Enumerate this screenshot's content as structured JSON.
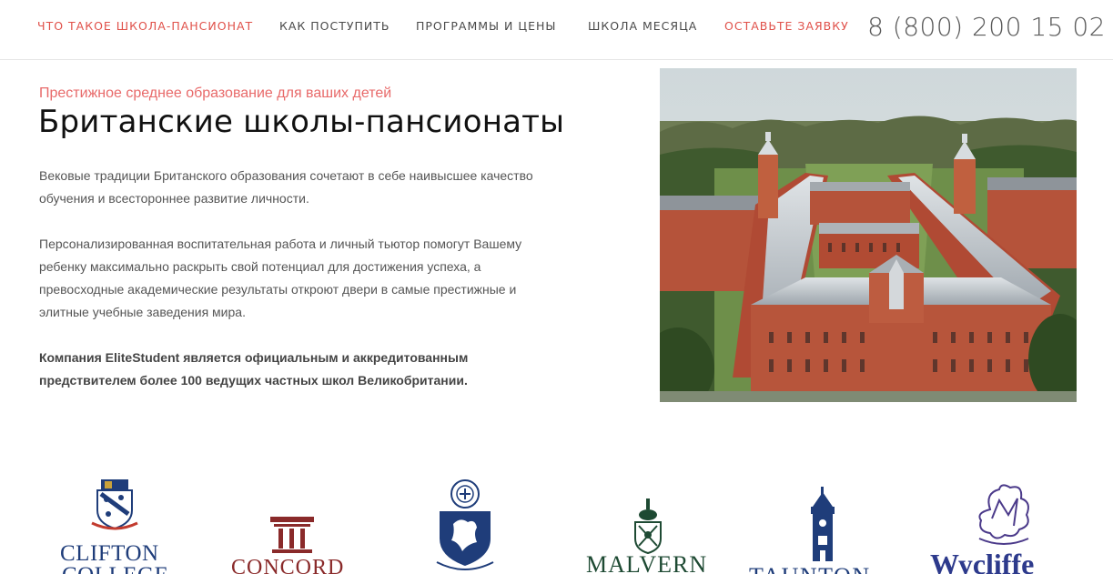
{
  "nav": {
    "items": [
      {
        "label": "ЧТО ТАКОЕ ШКОЛА-ПАНСИОНАТ"
      },
      {
        "label": "КАК ПОСТУПИТЬ"
      },
      {
        "label": "ПРОГРАММЫ И ЦЕНЫ"
      },
      {
        "label": "ШКОЛА МЕСЯЦА"
      },
      {
        "label": "ОСТАВЬТЕ ЗАЯВКУ"
      }
    ],
    "phone": "8 (800) 200 15 02"
  },
  "hero": {
    "kicker": "Престижное среднее образование для ваших детей",
    "title": "Британские школы-пансионаты",
    "paragraphs": [
      "Вековые традиции Британского образования сочетают в себе наивысшее качество обучения и всестороннее развитие личности.",
      "Персонализированная воспитательная работа и личный тьютор помогут Вашему ребенку максимально раскрыть свой потенциал для достижения успеха, а превосходные академические результаты откроют двери в самые престижные и элитные учебные заведения мира.",
      "Компания EliteStudent является официальным и аккредитованным предствителем более 100 ведущих частных школ Великобритании."
    ]
  },
  "logos": [
    {
      "name": "CLIFTON",
      "name2": "COLLEGE",
      "icon": "crest-icon"
    },
    {
      "name": "CONCORD",
      "icon": "columns-icon"
    },
    {
      "name": "",
      "icon": "shield-lion-icon"
    },
    {
      "name": "MALVERN",
      "icon": "crest-icon"
    },
    {
      "name": "TAUNTON",
      "icon": "tower-icon"
    },
    {
      "name": "Wycliffe",
      "icon": "griffin-icon"
    }
  ],
  "colors": {
    "accent": "#e0514a",
    "navy": "#1f3d7a",
    "maroon": "#8a2a2a",
    "green": "#1e4a33"
  }
}
